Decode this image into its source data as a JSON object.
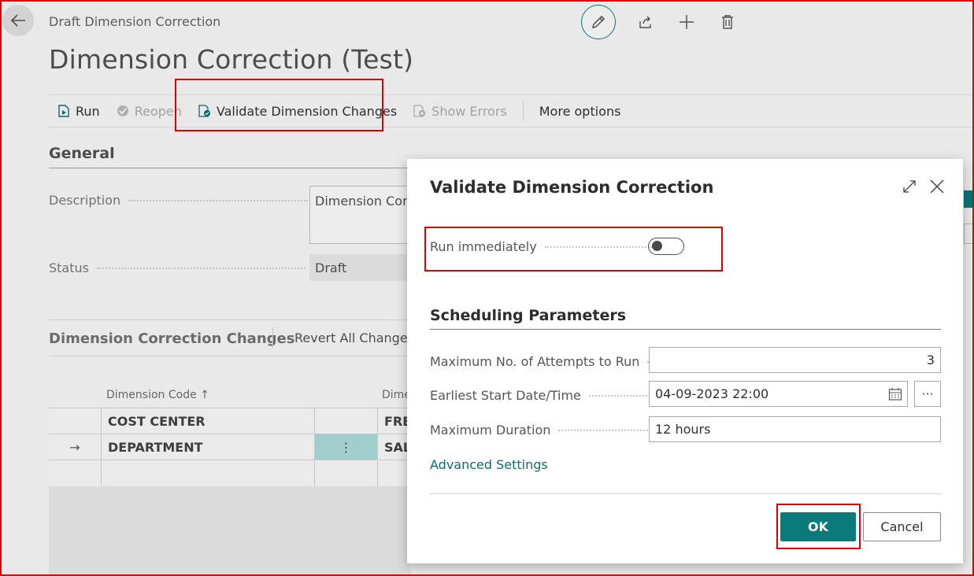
{
  "breadcrumb": "Draft Dimension Correction",
  "page_title": "Dimension Correction (Test)",
  "actions": {
    "run": "Run",
    "reopen": "Reopen",
    "validate": "Validate Dimension Changes",
    "show_errors": "Show Errors",
    "more": "More options"
  },
  "general": {
    "title": "General",
    "description_label": "Description",
    "description_value": "Dimension Correction (Test)",
    "status_label": "Status",
    "status_value": "Draft"
  },
  "changes": {
    "title": "Dimension Correction Changes",
    "revert_label": "Revert All Changes",
    "col_dimension_code": "Dimension Code ↑",
    "col_dimension_value": "Dimension Value",
    "rows": [
      {
        "marker": "",
        "code": "COST CENTER",
        "value": "FREIGHT"
      },
      {
        "marker": "→",
        "code": "DEPARTMENT",
        "value": "SALES"
      }
    ],
    "row_menu": "⋮"
  },
  "dialog": {
    "title": "Validate Dimension Correction",
    "run_immediately_label": "Run immediately",
    "run_immediately_on": false,
    "scheduling_title": "Scheduling Parameters",
    "max_attempts_label": "Maximum No. of Attempts to Run",
    "max_attempts_value": "3",
    "earliest_start_label": "Earliest Start Date/Time",
    "earliest_start_value": "04-09-2023 22:00",
    "max_duration_label": "Maximum Duration",
    "max_duration_value": "12 hours",
    "assist_label": "···",
    "advanced_link": "Advanced Settings",
    "ok_label": "OK",
    "cancel_label": "Cancel"
  },
  "colors": {
    "accent": "#0b7a7a",
    "highlight_border": "#e00000"
  }
}
